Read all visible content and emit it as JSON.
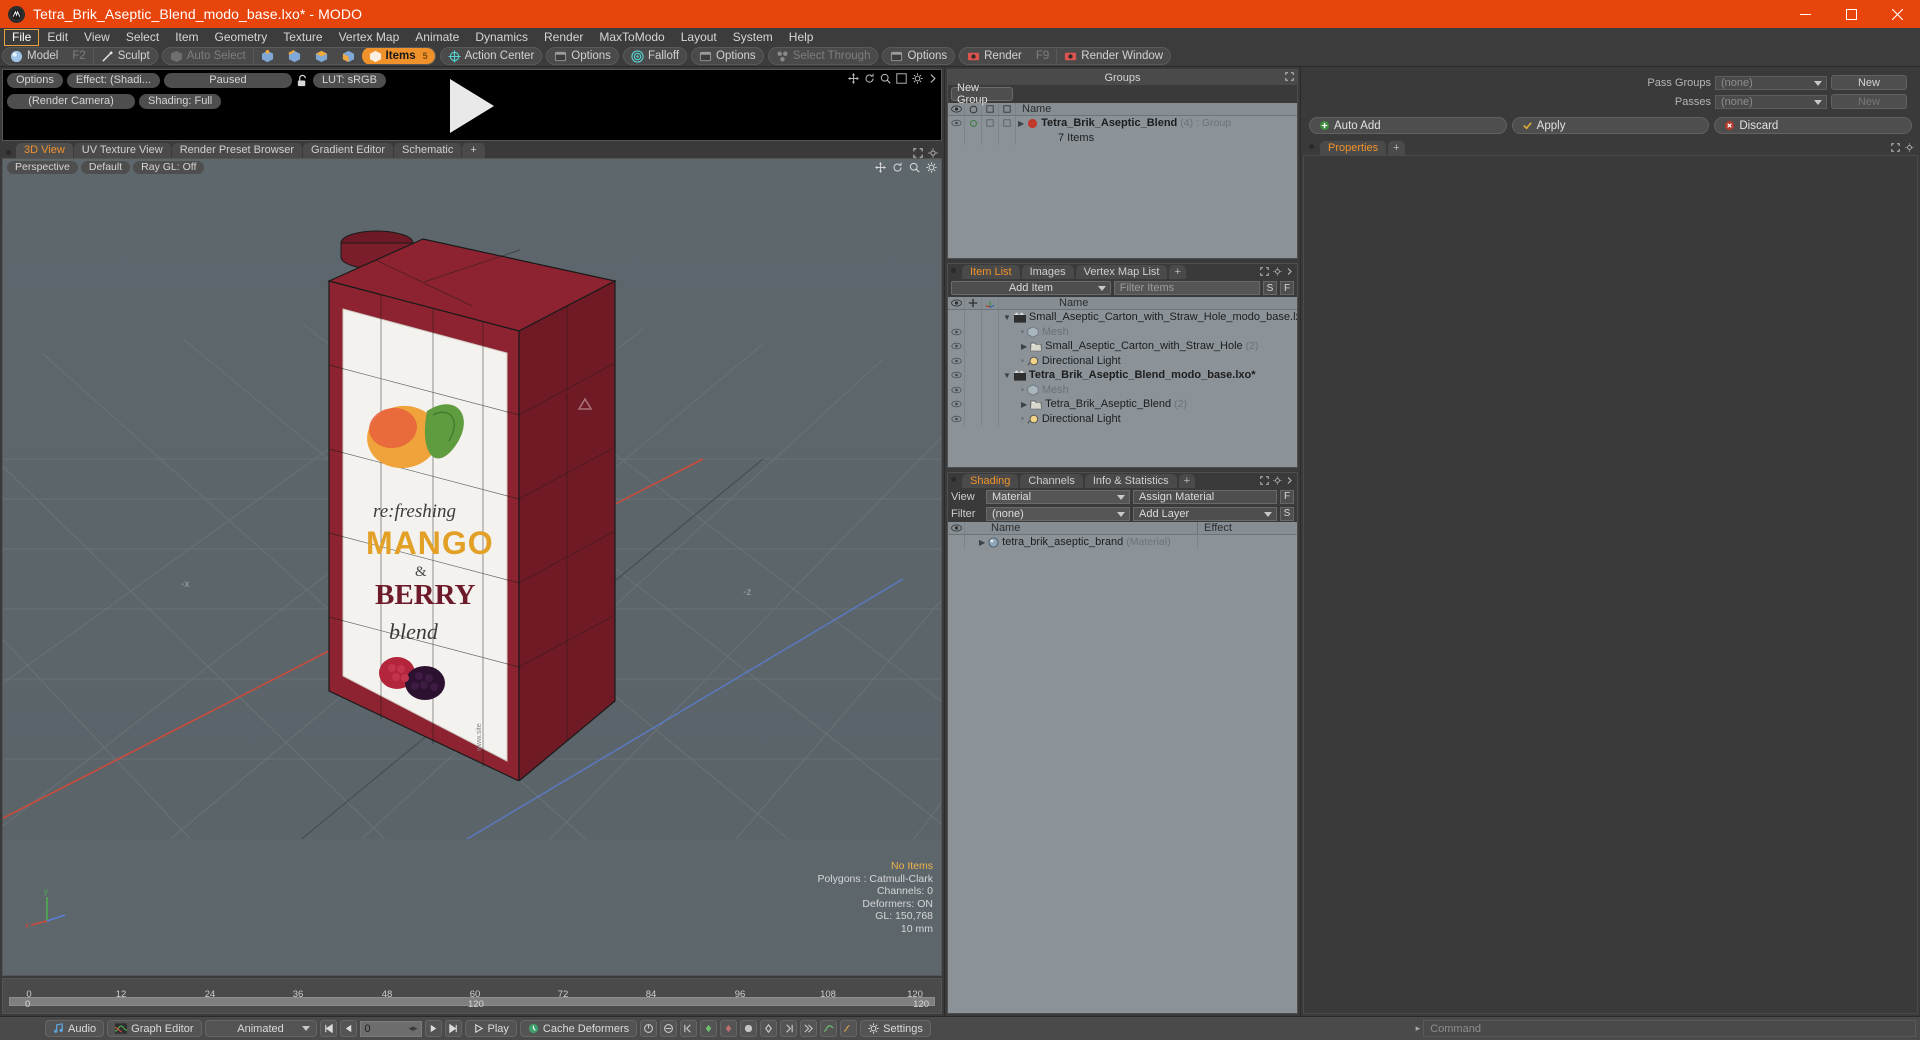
{
  "window": {
    "title": "Tetra_Brik_Aseptic_Blend_modo_base.lxo* - MODO",
    "app_icon": "modo-logo-icon",
    "minimize": "minimize-icon",
    "maximize": "maximize-icon",
    "close": "close-icon",
    "accent": "#e8450d"
  },
  "menubar": {
    "items": [
      {
        "label": "File",
        "active": true
      },
      {
        "label": "Edit",
        "active": false
      },
      {
        "label": "View",
        "active": false
      },
      {
        "label": "Select",
        "active": false
      },
      {
        "label": "Item",
        "active": false
      },
      {
        "label": "Geometry",
        "active": false
      },
      {
        "label": "Texture",
        "active": false
      },
      {
        "label": "Vertex Map",
        "active": false
      },
      {
        "label": "Animate",
        "active": false
      },
      {
        "label": "Dynamics",
        "active": false
      },
      {
        "label": "Render",
        "active": false
      },
      {
        "label": "MaxToModo",
        "active": false
      },
      {
        "label": "Layout",
        "active": false
      },
      {
        "label": "System",
        "active": false
      },
      {
        "label": "Help",
        "active": false
      }
    ]
  },
  "modebar": {
    "model_label": "Model",
    "model_shortcut": "F2",
    "sculpt_label": "Sculpt",
    "auto_select_label": "Auto Select",
    "items_label": "Items",
    "items_badge": "5",
    "action_center_label": "Action Center",
    "options_label": "Options",
    "falloff_label": "Falloff",
    "select_through_label": "Select Through",
    "render_label": "Render",
    "render_shortcut": "F9",
    "render_window_label": "Render Window",
    "selected_accent": "#f0922b"
  },
  "preview": {
    "options_label": "Options",
    "effect_label": "Effect: (Shadi...",
    "paused_label": "Paused",
    "lock_icon": "unlock-icon",
    "lut_label": "LUT: sRGB",
    "camera_label": "(Render Camera)",
    "shading_label": "Shading: Full",
    "play_icon": "play-triangle-icon",
    "tool_icons": [
      "move-icon",
      "refresh-icon",
      "zoom-icon",
      "fit-icon",
      "gear-icon",
      "arrow-right-icon"
    ]
  },
  "viewport_tabs": {
    "tabs": [
      {
        "label": "3D View",
        "active": true
      },
      {
        "label": "UV Texture View",
        "active": false
      },
      {
        "label": "Render Preset Browser",
        "active": false
      },
      {
        "label": "Gradient Editor",
        "active": false
      },
      {
        "label": "Schematic",
        "active": false
      },
      {
        "label": "+",
        "active": false
      }
    ]
  },
  "viewport": {
    "perspective_label": "Perspective",
    "default_label": "Default",
    "raygl_label": "Ray GL: Off",
    "tool_icons": [
      "move-icon",
      "rotate-icon",
      "zoom-icon",
      "gear-icon"
    ],
    "stats": {
      "selection": "No Items",
      "polygons": "Polygons : Catmull-Clark",
      "channels": "Channels: 0",
      "deformers": "Deformers: ON",
      "gl": "GL: 150,768",
      "scale": "10 mm"
    },
    "axis": {
      "x": "x",
      "y": "y",
      "z": "z"
    },
    "background_color": "#5c666b",
    "model_color": "#8d2230"
  },
  "timeline": {
    "ticks": [
      "0",
      "12",
      "24",
      "36",
      "48",
      "60",
      "72",
      "84",
      "96",
      "108",
      "120"
    ],
    "end_label": "120",
    "range_end": "120",
    "start_label": "0"
  },
  "groups_panel": {
    "title": "Groups",
    "new_group_label": "New Group",
    "column_name": "Name",
    "rows": [
      {
        "name": "Tetra_Brik_Aseptic_Blend",
        "count": "(4)",
        "type": ": Group",
        "sub": "7 Items"
      }
    ]
  },
  "item_list_panel": {
    "tabs": [
      {
        "label": "Item List",
        "active": true
      },
      {
        "label": "Images",
        "active": false
      },
      {
        "label": "Vertex Map List",
        "active": false
      },
      {
        "label": "+",
        "active": false
      }
    ],
    "add_item_label": "Add Item",
    "filter_placeholder": "Filter Items",
    "filter_s": "S",
    "filter_f": "F",
    "column_name": "Name",
    "rows": [
      {
        "indent": 0,
        "icon": "scene-icon",
        "name": "Small_Aseptic_Carton_with_Straw_Hole_modo_base.lxo*",
        "muted": false,
        "bold": false,
        "expanded": true,
        "eye": false
      },
      {
        "indent": 1,
        "icon": "mesh-icon",
        "name": "Mesh",
        "muted": true,
        "bold": false,
        "expanded": false,
        "eye": true
      },
      {
        "indent": 1,
        "icon": "folder-icon",
        "name": "Small_Aseptic_Carton_with_Straw_Hole",
        "suffix": "(2)",
        "muted": false,
        "bold": false,
        "expanded": false,
        "eye": true
      },
      {
        "indent": 1,
        "icon": "light-icon",
        "name": "Directional Light",
        "muted": false,
        "bold": false,
        "expanded": false,
        "eye": true
      },
      {
        "indent": 0,
        "icon": "scene-icon",
        "name": "Tetra_Brik_Aseptic_Blend_modo_base.lxo*",
        "muted": false,
        "bold": true,
        "expanded": true,
        "eye": true
      },
      {
        "indent": 1,
        "icon": "mesh-icon",
        "name": "Mesh",
        "muted": true,
        "bold": false,
        "expanded": false,
        "eye": true
      },
      {
        "indent": 1,
        "icon": "folder-icon",
        "name": "Tetra_Brik_Aseptic_Blend",
        "suffix": "(2)",
        "muted": false,
        "bold": false,
        "expanded": false,
        "eye": true
      },
      {
        "indent": 1,
        "icon": "light-icon",
        "name": "Directional Light",
        "muted": false,
        "bold": false,
        "expanded": false,
        "eye": true
      }
    ]
  },
  "shading_panel": {
    "tabs": [
      {
        "label": "Shading",
        "active": true
      },
      {
        "label": "Channels",
        "active": false
      },
      {
        "label": "Info & Statistics",
        "active": false
      },
      {
        "label": "+",
        "active": false
      }
    ],
    "view_label": "View",
    "view_value": "Material",
    "assign_material_label": "Assign Material",
    "assign_f": "F",
    "filter_label": "Filter",
    "filter_value": "(none)",
    "add_layer_label": "Add Layer",
    "add_layer_s": "S",
    "column_name": "Name",
    "column_effect": "Effect",
    "rows": [
      {
        "name": "tetra_brik_aseptic_brand",
        "type": "(Material)"
      }
    ]
  },
  "properties_panel": {
    "pass_groups_label": "Pass Groups",
    "pass_groups_value": "(none)",
    "new_label": "New",
    "passes_label": "Passes",
    "passes_value": "(none)",
    "passes_new_label": "New",
    "auto_add_label": "Auto Add",
    "apply_label": "Apply",
    "discard_label": "Discard",
    "properties_tab": "Properties",
    "properties_plus": "+"
  },
  "bottom_bar": {
    "audio_label": "Audio",
    "graph_editor_label": "Graph Editor",
    "animated_label": "Animated",
    "frame_value": "0",
    "play_label": "Play",
    "cache_deformers_label": "Cache Deformers",
    "settings_label": "Settings",
    "command_placeholder": "Command",
    "transport_icons": [
      "skip-start-icon",
      "step-back-icon",
      "step-forward-icon",
      "skip-end-icon",
      "play-icon"
    ]
  }
}
